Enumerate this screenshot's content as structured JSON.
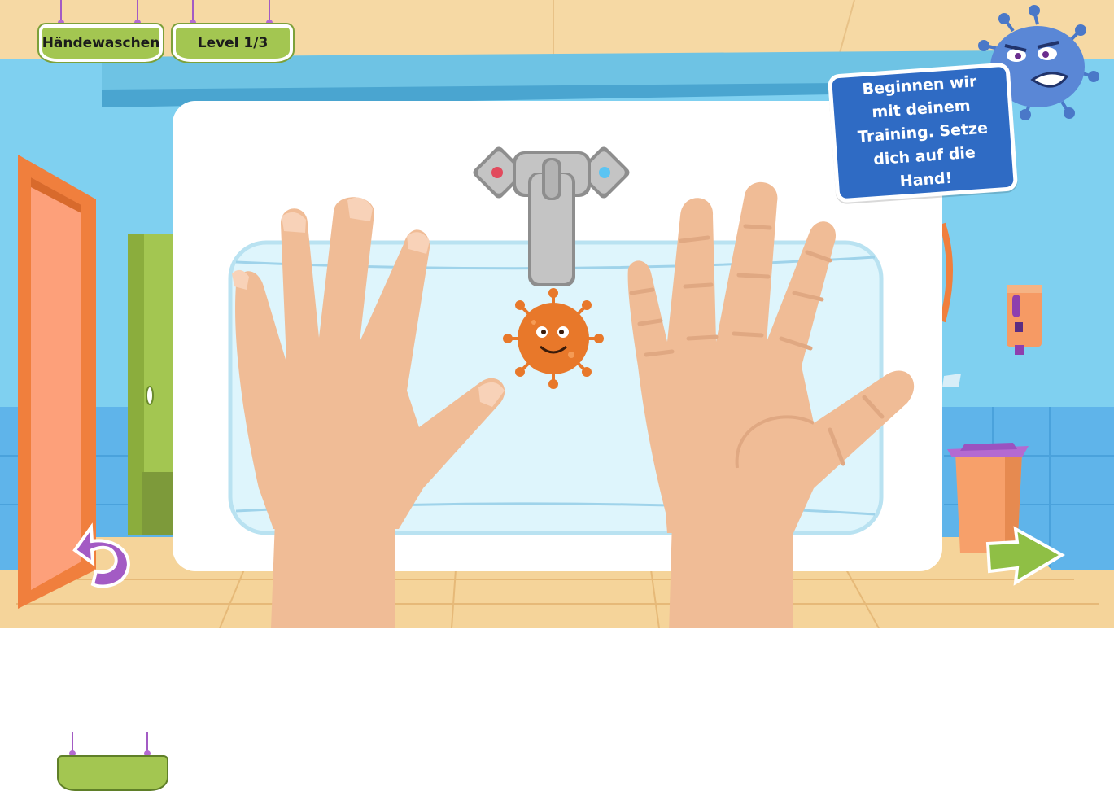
{
  "header": {
    "title": "Händewaschen",
    "level": "Level 1/3"
  },
  "speech_bubble": {
    "text": "Beginnen wir mit deinem Training. Setze dich auf die Hand!"
  },
  "colors": {
    "wall": "#7fd0f0",
    "ceiling": "#f6d9a4",
    "floor": "#f5d49a",
    "skin": "#f0bc96",
    "germ_orange": "#e8782a",
    "germ_blue": "#5a87d6",
    "sign_green": "#a3c651",
    "bubble_blue": "#2f6bc4",
    "undo_purple": "#a35bc4",
    "next_green": "#8fbf45"
  },
  "icons": {
    "undo": "undo-arrow-icon",
    "next": "right-arrow-icon",
    "player_germ": "orange-germ-icon",
    "mascot": "blue-germ-icon"
  }
}
